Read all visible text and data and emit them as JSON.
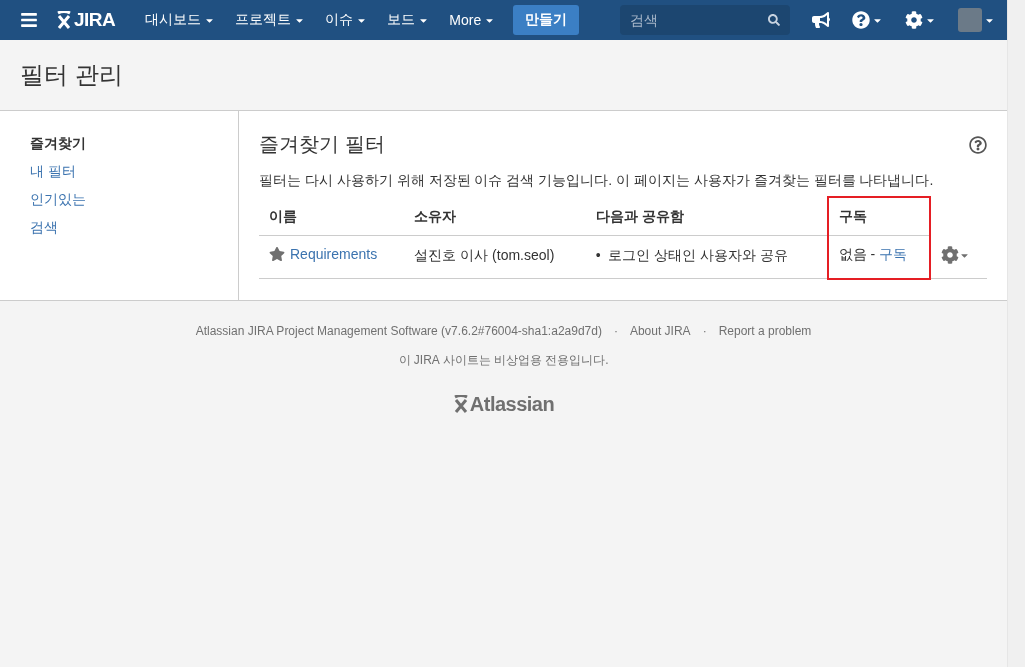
{
  "nav": {
    "logo": "JIRA",
    "menus": [
      {
        "label": "대시보드"
      },
      {
        "label": "프로젝트"
      },
      {
        "label": "이슈"
      },
      {
        "label": "보드"
      },
      {
        "label": "More"
      }
    ],
    "create": "만들기",
    "search": {
      "placeholder": "검색"
    }
  },
  "page_title": "필터 관리",
  "sidebar": {
    "items": [
      {
        "label": "즐겨찾기",
        "selected": true
      },
      {
        "label": "내 필터",
        "selected": false
      },
      {
        "label": "인기있는",
        "selected": false
      },
      {
        "label": "검색",
        "selected": false
      }
    ]
  },
  "content": {
    "title": "즐겨찾기 필터",
    "description": "필터는 다시 사용하기 위해 저장된 이슈 검색 기능입니다. 이 페이지는 사용자가 즐겨찾는 필터를 나타냅니다.",
    "table": {
      "columns": [
        {
          "label": "이름",
          "highlighted": false
        },
        {
          "label": "소유자",
          "highlighted": false
        },
        {
          "label": "다음과 공유함",
          "highlighted": false
        },
        {
          "label": "구독",
          "highlighted": true
        }
      ],
      "rows": [
        {
          "favorite": true,
          "name": "Requirements",
          "owner": "설진호 이사 (tom.seol)",
          "bullet": "•",
          "shared": "로그인 상태인 사용자와 공유",
          "subscriptions": "없음 -",
          "subscribe": "구독"
        }
      ]
    }
  },
  "footer": {
    "links": [
      {
        "label": "Atlassian JIRA Project Management Software (v7.6.2#76004-sha1:a2a9d7d)"
      },
      {
        "label": "About JIRA"
      },
      {
        "label": "Report a problem"
      }
    ],
    "separator": "·",
    "note": "이 JIRA 사이트는 비상업용 전용입니다.",
    "logo": "Atlassian"
  }
}
